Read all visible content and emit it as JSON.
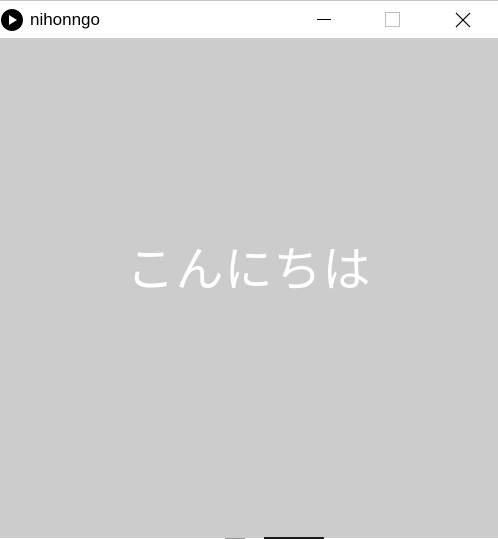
{
  "window": {
    "title": "nihonngo",
    "app_icon": "play-icon"
  },
  "controls": {
    "minimize_icon": "minimize-icon",
    "maximize_icon": "maximize-icon",
    "close_icon": "close-icon"
  },
  "canvas": {
    "background": "#cccccc",
    "text": "こんにちは",
    "text_color": "#ffffff"
  }
}
